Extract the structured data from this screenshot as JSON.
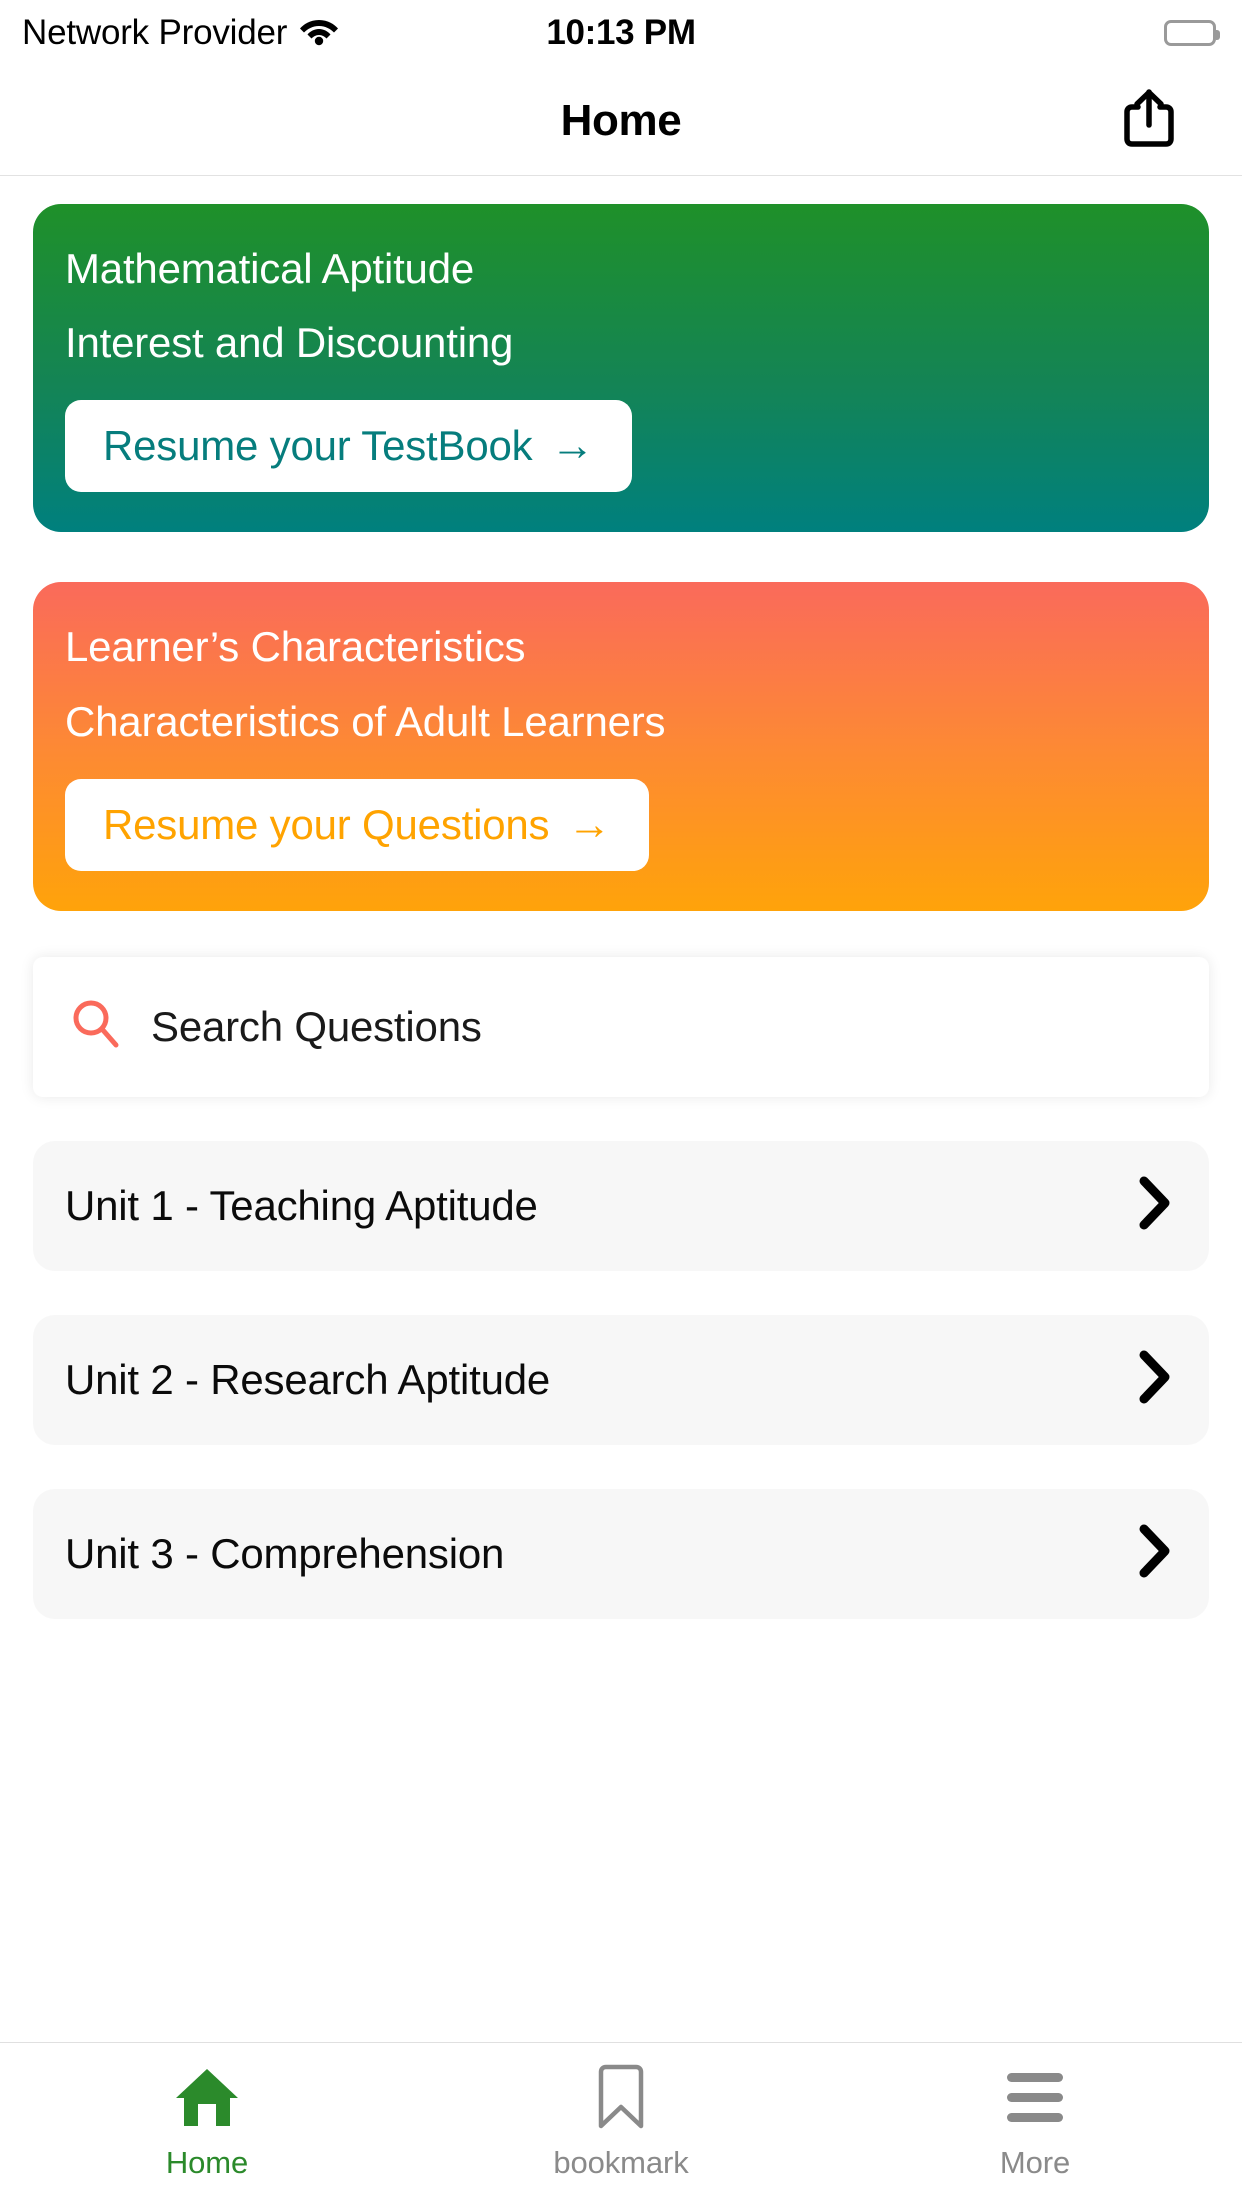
{
  "status_bar": {
    "carrier": "Network Provider",
    "time": "10:13 PM",
    "wifi_icon": "wifi-icon",
    "battery_icon": "battery-full-icon"
  },
  "nav_bar": {
    "title": "Home",
    "share_icon": "share-icon"
  },
  "cards": [
    {
      "title": "Mathematical Aptitude",
      "subtitle": "Interest and Discounting",
      "button_label": "Resume your TestBook",
      "button_arrow": "→",
      "gradient_from": "#1f9029",
      "gradient_to": "#00807e",
      "button_text_color": "#067d7d"
    },
    {
      "title": "Learner’s Characteristics",
      "subtitle": "Characteristics of Adult Learners",
      "button_label": "Resume your Questions",
      "button_arrow": "→",
      "gradient_from": "#fa6a5b",
      "gradient_to": "#ffa30a",
      "button_text_color": "#ffa300"
    }
  ],
  "search": {
    "placeholder": "Search Questions",
    "value": "",
    "icon": "search-icon",
    "icon_color": "#fa6a5b"
  },
  "units": [
    {
      "label": "Unit 1 - Teaching Aptitude",
      "chevron": "chevron-right-icon"
    },
    {
      "label": "Unit 2 - Research Aptitude",
      "chevron": "chevron-right-icon"
    },
    {
      "label": "Unit 3 - Comprehension",
      "chevron": "chevron-right-icon"
    }
  ],
  "tab_bar": {
    "active_color": "#2b8a2b",
    "inactive_color": "#8a8a8a",
    "items": [
      {
        "label": "Home",
        "icon": "home-icon",
        "active": true
      },
      {
        "label": "bookmark",
        "icon": "bookmark-icon",
        "active": false
      },
      {
        "label": "More",
        "icon": "hamburger-menu-icon",
        "active": false
      }
    ]
  }
}
